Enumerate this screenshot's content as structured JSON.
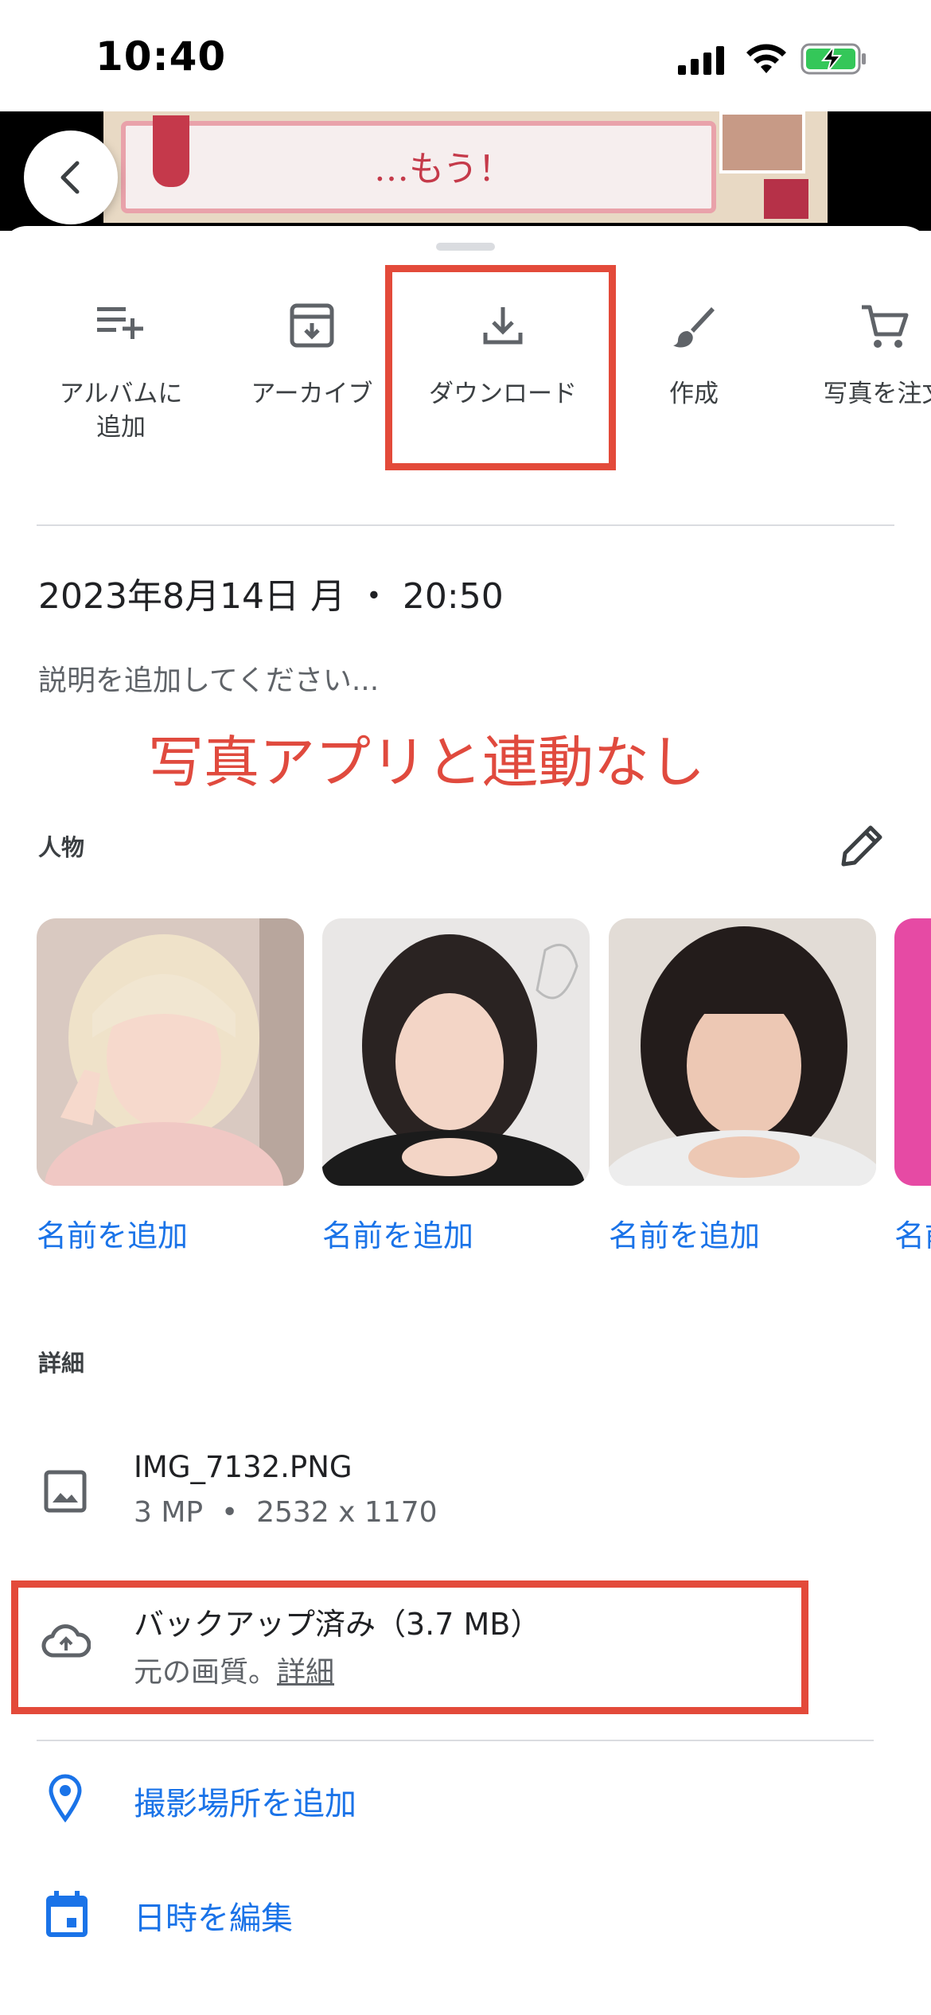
{
  "status_bar": {
    "time": "10:40"
  },
  "banner": {
    "text": "…もう！"
  },
  "actions": [
    {
      "label": "アルバムに\n追加",
      "icon": "playlist-add-icon"
    },
    {
      "label": "アーカイブ",
      "icon": "archive-icon"
    },
    {
      "label": "ダウンロード",
      "icon": "download-icon"
    },
    {
      "label": "作成",
      "icon": "brush-icon"
    },
    {
      "label": "写真を注文",
      "icon": "cart-icon"
    }
  ],
  "info": {
    "date": "2023年8月14日 月 ・ 20:50",
    "description_placeholder": "説明を追加してください...",
    "annotation": "写真アプリと連動なし"
  },
  "people": {
    "heading": "人物",
    "items": [
      {
        "name": "名前を追加"
      },
      {
        "name": "名前を追加"
      },
      {
        "name": "名前を追加"
      },
      {
        "name": "名前を追加"
      }
    ]
  },
  "details": {
    "heading": "詳細",
    "file_name": "IMG_7132.PNG",
    "file_meta": "3 MP  •  2532 x 1170",
    "backup_title": "バックアップ済み（3.7 MB）",
    "backup_quality": "元の画質。",
    "backup_link": "詳細",
    "add_location": "撮影場所を追加",
    "edit_datetime": "日時を編集"
  },
  "colors": {
    "accent_blue": "#1a73e8",
    "highlight_red": "#e34a3a",
    "annotation_red": "#e04a3e"
  }
}
